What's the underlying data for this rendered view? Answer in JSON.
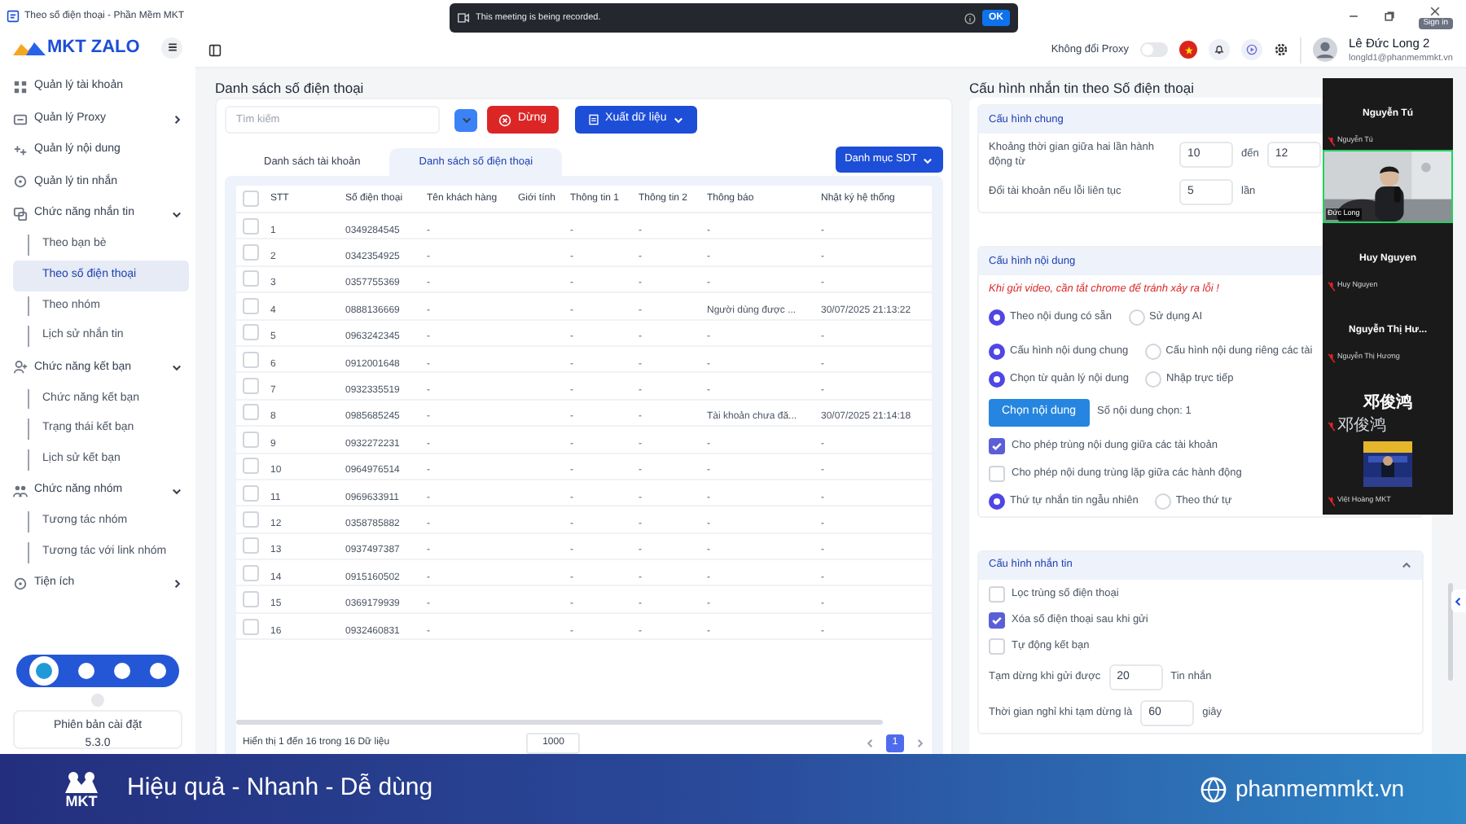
{
  "window": {
    "title": "Theo số điện thoại - Phần Mềm MKT",
    "sign_in": "Sign in"
  },
  "toast": {
    "message": "This meeting is being recorded.",
    "button": "OK"
  },
  "sidebar": {
    "logo": "MKT ZALO",
    "items": [
      {
        "kind": "link",
        "label": "Quản lý tài khoản"
      },
      {
        "kind": "group",
        "label": "Quản lý Proxy",
        "expanded": false
      },
      {
        "kind": "link",
        "label": "Quản lý nội dung"
      },
      {
        "kind": "link",
        "label": "Quản lý tin nhắn"
      },
      {
        "kind": "group",
        "label": "Chức năng nhắn tin",
        "expanded": true,
        "children": [
          {
            "label": "Theo bạn bè",
            "selected": false
          },
          {
            "label": "Theo số điện thoại",
            "selected": true
          },
          {
            "label": "Theo nhóm",
            "selected": false
          },
          {
            "label": "Lịch sử nhắn tin",
            "selected": false
          }
        ]
      },
      {
        "kind": "group",
        "label": "Chức năng kết bạn",
        "expanded": true,
        "children": [
          {
            "label": "Chức năng kết bạn",
            "selected": false
          },
          {
            "label": "Trạng thái kết bạn",
            "selected": false
          },
          {
            "label": "Lịch sử kết bạn",
            "selected": false
          }
        ]
      },
      {
        "kind": "group",
        "label": "Chức năng nhóm",
        "expanded": true,
        "children": [
          {
            "label": "Tương tác nhóm",
            "selected": false
          },
          {
            "label": "Tương tác với link nhóm",
            "selected": false
          }
        ]
      },
      {
        "kind": "group",
        "label": "Tiện ích",
        "expanded": false
      }
    ],
    "version": {
      "label": "Phiên bản cài đặt",
      "number": "5.3.0"
    }
  },
  "header": {
    "proxy": {
      "label": "Không đổi Proxy",
      "on": false
    },
    "user": {
      "name": "Lê Đức Long 2",
      "email": "longld1@phanmemmkt.vn"
    }
  },
  "phone_list": {
    "title": "Danh sách số điện thoại",
    "search_placeholder": "Tìm kiếm",
    "stop_button": "Dừng",
    "export_button": "Xuất dữ liệu",
    "tabs": [
      {
        "label": "Danh sách tài khoản",
        "selected": false
      },
      {
        "label": "Danh sách số điện thoại",
        "selected": true
      }
    ],
    "category_button": "Danh mục SDT",
    "table": {
      "all_checked": false,
      "columns": [
        "STT",
        "Số điện thoại",
        "Tên khách hàng",
        "Giới tính",
        "Thông tin 1",
        "Thông tin 2",
        "Thông báo",
        "Nhật ký hệ thống"
      ],
      "rows": [
        {
          "checked": false,
          "cells": [
            "1",
            "0349284545",
            "-",
            "",
            "-",
            "-",
            "-",
            "-"
          ]
        },
        {
          "checked": false,
          "cells": [
            "2",
            "0342354925",
            "-",
            "",
            "-",
            "-",
            "-",
            "-"
          ]
        },
        {
          "checked": false,
          "cells": [
            "3",
            "0357755369",
            "-",
            "",
            "-",
            "-",
            "-",
            "-"
          ]
        },
        {
          "checked": false,
          "cells": [
            "4",
            "0888136669",
            "-",
            "",
            "-",
            "-",
            "Người dùng được ...",
            "30/07/2025 21:13:22"
          ]
        },
        {
          "checked": false,
          "cells": [
            "5",
            "0963242345",
            "-",
            "",
            "-",
            "-",
            "-",
            "-"
          ]
        },
        {
          "checked": false,
          "cells": [
            "6",
            "0912001648",
            "-",
            "",
            "-",
            "-",
            "-",
            "-"
          ]
        },
        {
          "checked": false,
          "cells": [
            "7",
            "0932335519",
            "-",
            "",
            "-",
            "-",
            "-",
            "-"
          ]
        },
        {
          "checked": false,
          "cells": [
            "8",
            "0985685245",
            "-",
            "",
            "-",
            "-",
            "Tài khoản chưa đă...",
            "30/07/2025 21:14:18"
          ]
        },
        {
          "checked": false,
          "cells": [
            "9",
            "0932272231",
            "-",
            "",
            "-",
            "-",
            "-",
            "-"
          ]
        },
        {
          "checked": false,
          "cells": [
            "10",
            "0964976514",
            "-",
            "",
            "-",
            "-",
            "-",
            "-"
          ]
        },
        {
          "checked": false,
          "cells": [
            "11",
            "0969633911",
            "-",
            "",
            "-",
            "-",
            "-",
            "-"
          ]
        },
        {
          "checked": false,
          "cells": [
            "12",
            "0358785882",
            "-",
            "",
            "-",
            "-",
            "-",
            "-"
          ]
        },
        {
          "checked": false,
          "cells": [
            "13",
            "0937497387",
            "-",
            "",
            "-",
            "-",
            "-",
            "-"
          ]
        },
        {
          "checked": false,
          "cells": [
            "14",
            "0915160502",
            "-",
            "",
            "-",
            "-",
            "-",
            "-"
          ]
        },
        {
          "checked": false,
          "cells": [
            "15",
            "0369179939",
            "-",
            "",
            "-",
            "-",
            "-",
            "-"
          ]
        },
        {
          "checked": false,
          "cells": [
            "16",
            "0932460831",
            "-",
            "",
            "-",
            "-",
            "-",
            "-"
          ]
        }
      ]
    },
    "footer": "Hiển thị 1 đến 16 trong 16 Dữ liệu",
    "page_size": "1000",
    "pages": [
      {
        "label": "1",
        "selected": true
      }
    ]
  },
  "config": {
    "title": "Cấu hình nhắn tin theo Số điện thoại",
    "general": {
      "title": "Cấu hình chung",
      "interval_label": "Khoảng thời gian giữa hai lần hành động từ",
      "interval_from": "10",
      "interval_to_label": "đến",
      "interval_to": "12",
      "switch_label": "Đổi tài khoản nếu lỗi liên tục",
      "switch_value": "5",
      "switch_unit": "lần"
    },
    "content": {
      "title": "Cấu hình nội dung",
      "warning": "Khi gửi video, cần tắt chrome để tránh xảy ra lỗi !",
      "radio_groups": [
        [
          {
            "label": "Theo nội dung có sẵn",
            "selected": true
          },
          {
            "label": "Sử dụng AI",
            "selected": false
          }
        ],
        [
          {
            "label": "Cấu hình nội dung chung",
            "selected": true
          },
          {
            "label": "Cấu hình nội dung riêng các tài",
            "selected": false
          }
        ],
        [
          {
            "label": "Chọn từ quản lý nội dung",
            "selected": true
          },
          {
            "label": "Nhập trực tiếp",
            "selected": false
          }
        ]
      ],
      "choose_button": "Chọn nội dung",
      "chosen_count": "Số nội dung chọn: 1",
      "checkboxes": [
        {
          "label": "Cho phép trùng nội dung giữa các tài khoản",
          "checked": true
        },
        {
          "label": "Cho phép nội dung trùng lặp giữa các hành động",
          "checked": false
        }
      ],
      "order": [
        {
          "label": "Thứ tự nhắn tin ngẫu nhiên",
          "selected": true
        },
        {
          "label": "Theo thứ tự",
          "selected": false
        }
      ]
    },
    "messaging": {
      "title": "Cấu hình nhắn tin",
      "expanded": true,
      "checkboxes": [
        {
          "label": "Lọc trùng số điện thoại",
          "checked": false
        },
        {
          "label": "Xóa số điện thoại sau khi gửi",
          "checked": true
        },
        {
          "label": "Tự động kết bạn",
          "checked": false
        }
      ],
      "pause_label": "Tạm dừng khi gửi được",
      "pause_value": "20",
      "pause_unit": "Tin nhắn",
      "rest_label": "Thời gian nghỉ khi tạm dừng là",
      "rest_value": "60",
      "rest_unit": "giây"
    }
  },
  "participants": [
    {
      "kind": "name",
      "name": "Nguyễn Tú",
      "label": "Nguyễn Tú"
    },
    {
      "kind": "video",
      "label": "Đức Long"
    },
    {
      "kind": "name",
      "name": "Huy Nguyen",
      "label": "Huy Nguyen"
    },
    {
      "kind": "name",
      "name": "Nguyễn Thị Hư...",
      "label": "Nguyễn Thị Hương"
    },
    {
      "kind": "name",
      "name": "邓俊鸿",
      "label": "邓俊鸿"
    },
    {
      "kind": "thumbnail",
      "label": "Việt Hoàng MKT"
    }
  ],
  "banner": {
    "logo": "MKT",
    "slogan": "Hiệu quả - Nhanh - Dễ dùng",
    "site": "phanmemmkt.vn"
  }
}
